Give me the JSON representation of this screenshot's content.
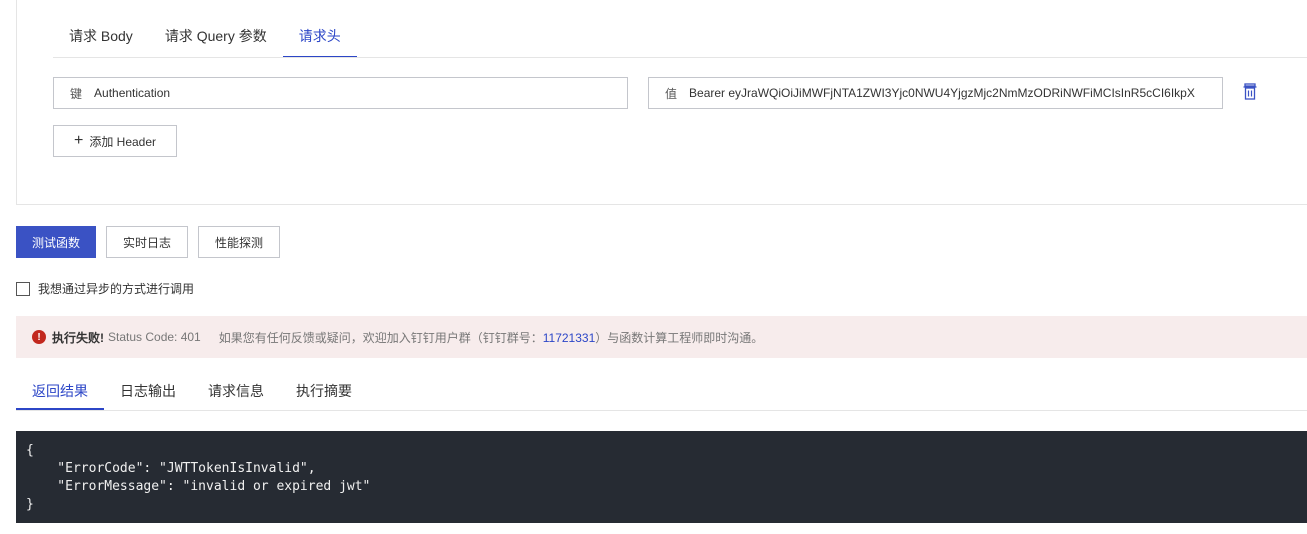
{
  "request_tabs": [
    {
      "label": "请求 Body"
    },
    {
      "label": "请求 Query 参数"
    },
    {
      "label": "请求头"
    }
  ],
  "header_row": {
    "key_prefix": "键",
    "key_value": "Authentication",
    "value_prefix": "值",
    "value_value": "Bearer eyJraWQiOiJiMWFjNTA1ZWI3Yjc0NWU4YjgzMjc2NmMzODRiNWFiMCIsInR5cCI6IkpX"
  },
  "add_header_label": "添加 Header",
  "actions": {
    "test": "测试函数",
    "log": "实时日志",
    "perf": "性能探测"
  },
  "async_label": "我想通过异步的方式进行调用",
  "alert": {
    "fail_label": "执行失败!",
    "status": "Status Code: 401",
    "message_before": "如果您有任何反馈或疑问，欢迎加入钉钉用户群（钉钉群号：",
    "group_number": "11721331",
    "message_after": "）与函数计算工程师即时沟通。"
  },
  "result_tabs": [
    {
      "label": "返回结果"
    },
    {
      "label": "日志输出"
    },
    {
      "label": "请求信息"
    },
    {
      "label": "执行摘要"
    }
  ],
  "response_body": "{\n    \"ErrorCode\": \"JWTTokenIsInvalid\",\n    \"ErrorMessage\": \"invalid or expired jwt\"\n}",
  "colors": {
    "accent": "#2c46c7",
    "primary_button": "#3a52c4",
    "alert_background": "#f7ecec",
    "error": "#c2281e",
    "code_background": "#262b33"
  }
}
